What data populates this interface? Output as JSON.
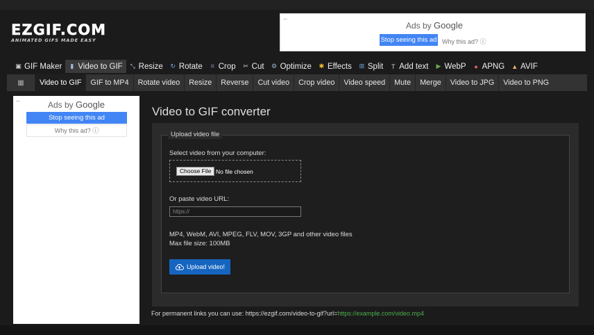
{
  "logo": {
    "main": "EZGIF.COM",
    "tagline": "ANIMATED GIFS MADE EASY"
  },
  "top_ad": {
    "back_arrow": "←",
    "ads_by": "Ads by",
    "google": "Google",
    "stop": "Stop seeing this ad",
    "why": "Why this ad?",
    "info_icon": "ⓘ"
  },
  "nav": [
    {
      "label": "GIF Maker",
      "icon": "▣",
      "icon_color": "#cfcfcf"
    },
    {
      "label": "Video to GIF",
      "icon": "▮",
      "icon_color": "#9fb7d6"
    },
    {
      "label": "Resize",
      "icon": "⤡",
      "icon_color": "#9fb7d6"
    },
    {
      "label": "Rotate",
      "icon": "↻",
      "icon_color": "#6fa8dc"
    },
    {
      "label": "Crop",
      "icon": "⌗",
      "icon_color": "#9fb7d6"
    },
    {
      "label": "Cut",
      "icon": "✂",
      "icon_color": "#cfcfcf"
    },
    {
      "label": "Optimize",
      "icon": "⚙",
      "icon_color": "#9fb7d6"
    },
    {
      "label": "Effects",
      "icon": "✱",
      "icon_color": "#f1c232"
    },
    {
      "label": "Split",
      "icon": "⊞",
      "icon_color": "#6fa8dc"
    },
    {
      "label": "Add text",
      "icon": "T",
      "icon_color": "#cfcfcf"
    },
    {
      "label": "WebP",
      "icon": "▶",
      "icon_color": "#6aa84f"
    },
    {
      "label": "APNG",
      "icon": "●",
      "icon_color": "#e06666"
    },
    {
      "label": "AVIF",
      "icon": "▲",
      "icon_color": "#f6b26b"
    }
  ],
  "subnav": {
    "icon": "▦",
    "items": [
      "Video to GIF",
      "GIF to MP4",
      "Rotate video",
      "Resize",
      "Reverse",
      "Cut video",
      "Crop video",
      "Video speed",
      "Mute",
      "Merge",
      "Video to JPG",
      "Video to PNG"
    ]
  },
  "left_ad": {
    "back_arrow": "←",
    "ads_by": "Ads by",
    "google": "Google",
    "stop": "Stop seeing this ad",
    "why": "Why this ad?",
    "info_icon": "ⓘ"
  },
  "main": {
    "title": "Video to GIF converter",
    "legend": "Upload video file",
    "select_label": "Select video from your computer:",
    "choose_file": "Choose File",
    "no_file": "No file chosen",
    "url_label": "Or paste video URL:",
    "url_placeholder": "https://",
    "formats": "MP4, WebM, AVI, MPEG, FLV, MOV, 3GP and other video files",
    "max_size": "Max file size: 100MB",
    "upload": "Upload video!"
  },
  "permanent": {
    "prefix": "For permanent links you can use: https://ezgif.com/video-to-gif?url=",
    "example": "https://example.com/video.mp4"
  }
}
